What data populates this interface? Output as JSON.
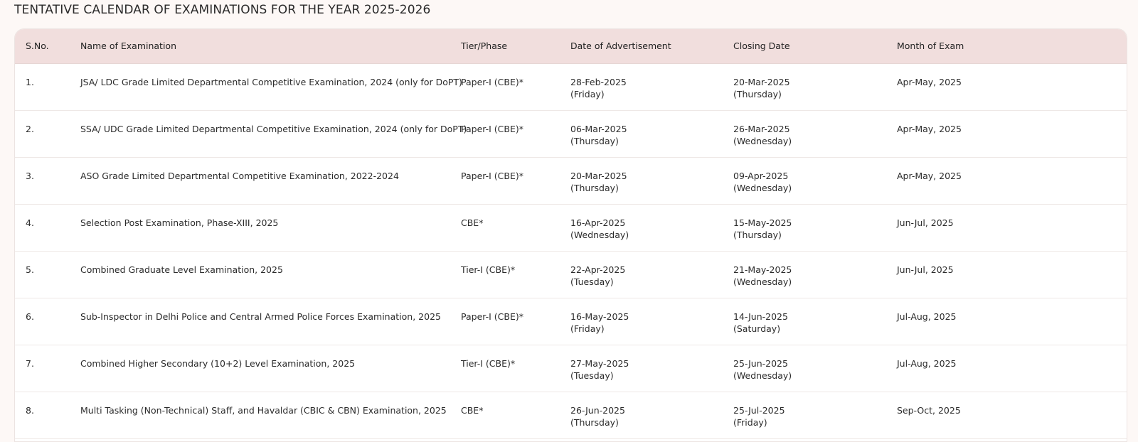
{
  "page": {
    "title": "TENTATIVE CALENDAR OF EXAMINATIONS FOR THE YEAR 2025-2026"
  },
  "table": {
    "headers": {
      "sno": "S.No.",
      "name": "Name of Examination",
      "tier": "Tier/Phase",
      "advertisement": "Date of Advertisement",
      "closing": "Closing Date",
      "month": "Month of Exam"
    },
    "rows": [
      {
        "sno": "1.",
        "name": "JSA/ LDC Grade Limited Departmental Competitive Examination, 2024 (only for DoPT)",
        "tier": "Paper-I (CBE)*",
        "adv_date": "28-Feb-2025",
        "adv_day": "(Friday)",
        "close_date": "20-Mar-2025",
        "close_day": "(Thursday)",
        "month": "Apr-May, 2025"
      },
      {
        "sno": "2.",
        "name": "SSA/ UDC Grade Limited Departmental Competitive Examination, 2024 (only for DoPT)",
        "tier": "Paper-I (CBE)*",
        "adv_date": "06-Mar-2025",
        "adv_day": "(Thursday)",
        "close_date": "26-Mar-2025",
        "close_day": "(Wednesday)",
        "month": "Apr-May, 2025"
      },
      {
        "sno": "3.",
        "name": "ASO Grade Limited Departmental Competitive Examination, 2022-2024",
        "tier": "Paper-I (CBE)*",
        "adv_date": "20-Mar-2025",
        "adv_day": "(Thursday)",
        "close_date": "09-Apr-2025",
        "close_day": "(Wednesday)",
        "month": "Apr-May, 2025"
      },
      {
        "sno": "4.",
        "name": "Selection Post Examination, Phase-XIII, 2025",
        "tier": "CBE*",
        "adv_date": "16-Apr-2025",
        "adv_day": "(Wednesday)",
        "close_date": "15-May-2025",
        "close_day": "(Thursday)",
        "month": "Jun-Jul, 2025"
      },
      {
        "sno": "5.",
        "name": "Combined Graduate Level Examination, 2025",
        "tier": "Tier-I (CBE)*",
        "adv_date": "22-Apr-2025",
        "adv_day": "(Tuesday)",
        "close_date": "21-May-2025",
        "close_day": "(Wednesday)",
        "month": "Jun-Jul, 2025"
      },
      {
        "sno": "6.",
        "name": "Sub-Inspector in Delhi Police and Central Armed Police Forces Examination, 2025",
        "tier": "Paper-I (CBE)*",
        "adv_date": "16-May-2025",
        "adv_day": "(Friday)",
        "close_date": "14-Jun-2025",
        "close_day": "(Saturday)",
        "month": "Jul-Aug, 2025"
      },
      {
        "sno": "7.",
        "name": "Combined Higher Secondary (10+2) Level Examination, 2025",
        "tier": "Tier-I (CBE)*",
        "adv_date": "27-May-2025",
        "adv_day": "(Tuesday)",
        "close_date": "25-Jun-2025",
        "close_day": "(Wednesday)",
        "month": "Jul-Aug, 2025"
      },
      {
        "sno": "8.",
        "name": "Multi Tasking (Non-Technical) Staff, and Havaldar (CBIC & CBN) Examination, 2025",
        "tier": "CBE*",
        "adv_date": "26-Jun-2025",
        "adv_day": "(Thursday)",
        "close_date": "25-Jul-2025",
        "close_day": "(Friday)",
        "month": "Sep-Oct, 2025"
      }
    ]
  }
}
